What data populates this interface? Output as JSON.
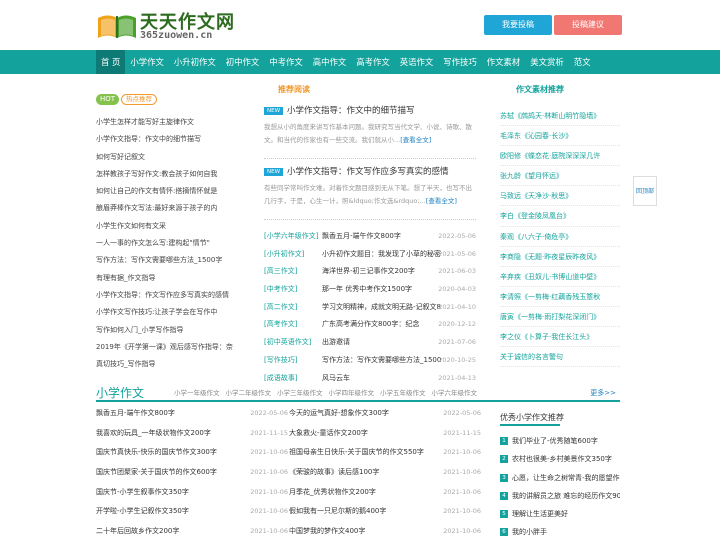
{
  "logo": {
    "cn": "天天作文网",
    "en": "365zuowen.cn"
  },
  "header": {
    "submit": "我要投稿",
    "suggest": "投稿建议"
  },
  "nav": [
    "首 页",
    "小学作文",
    "小升初作文",
    "初中作文",
    "中考作文",
    "高中作文",
    "高考作文",
    "英语作文",
    "写作技巧",
    "作文素材",
    "美文赏析",
    "范文"
  ],
  "hot": {
    "tag": "HOT",
    "sub": "热点推荐",
    "items": [
      "小学生怎样才能写好主旋律作文",
      "小学作文指导：作文中的细节描写",
      "如何写好记叙文",
      "怎样教孩子写好作文:教会孩子如何自我",
      "如何让自己的作文有情怀:搭摘情怀就是",
      "酿眉莽棒作文写法:最好来源于孩子的内",
      "小学生作文如何有文采",
      "一人一事的作文怎么写:建构起\"情节\"",
      "写作方法：写作文需要哪些方法_1500字",
      "有理有据_作文指导",
      "小学作文指导：作文写作应多写真实的感情",
      "小学作文写作技巧:让孩子学会在写作中",
      "写作如何入门_小学写作指导",
      "2019年《开学第一课》观后感写作指导：奈",
      "真切技巧_写作指导"
    ]
  },
  "recommend": {
    "title": "推荐阅读",
    "more": "[查看全文]",
    "articles": [
      {
        "badge": "NEW",
        "title": "小学作文指导：作文中的细节描写",
        "summary": "我想从小的角度来讲写作基本问题。我研究写当代文学、小说、诗歌、散文。和当代的作家也有一些交流。我们就从小..."
      },
      {
        "badge": "NEW",
        "title": "小学作文指导：作文写作应多写真实的感情",
        "summary": "有些同学常叫作文难。对着作文题目感到无从下笔。想了半天，也写不出几行字，于是，心生一计，照&ldquo;作文选&rdquo;..."
      }
    ],
    "list": [
      {
        "cat": "[小学六年级作文]",
        "title": "飘香五月-端午作文800字",
        "date": "2022-05-06"
      },
      {
        "cat": "[小升初作文]",
        "title": "小升初作文题目：我发现了小草的秘密",
        "date": "2021-05-06"
      },
      {
        "cat": "[高三作文]",
        "title": "海洋世界-初三记事作文200字",
        "date": "2021-06-03"
      },
      {
        "cat": "[中考作文]",
        "title": "那一年 优秀中考作文1500字",
        "date": "2020-04-03"
      },
      {
        "cat": "[高二作文]",
        "title": "学习文明精神，成就文明无路-记叙文8",
        "date": "2021-04-10"
      },
      {
        "cat": "[高考作文]",
        "title": "广东高考满分作文800字：纪念",
        "date": "2020-12-12"
      },
      {
        "cat": "[初中英语作文]",
        "title": "出游邀请",
        "date": "2021-07-06"
      },
      {
        "cat": "[写作技巧]",
        "title": "写作方法：写作文需要哪些方法_1500",
        "date": "2020-10-25"
      },
      {
        "cat": "[成语故事]",
        "title": "风马云车",
        "date": "2021-04-13"
      }
    ]
  },
  "materials": {
    "title": "作文素材推荐",
    "items": [
      "苏轼《鹧鸪天·林断山明竹隐墙》",
      "毛泽东《沁园春·长沙》",
      "欧阳修《蝶恋花·庭院深深深几许",
      "张九龄《望月怀远》",
      "马致远《天净沙·秋思》",
      "李白《登金陵凤凰台》",
      "秦观《八六子·倚危亭》",
      "李商隐《无题·昨夜星辰昨夜风》",
      "辛弃疾《丑奴儿·书博山道中壁》",
      "李清照《一剪梅·红藕香残玉簟秋",
      "唐寅《一剪梅·雨打梨花深闭门》",
      "李之仪《卜算子·我住长江头》",
      "关于诚信的名言警句"
    ]
  },
  "back_top": "回顶部",
  "primary": {
    "title": "小学作文",
    "tabs": [
      "小学一年级作文",
      "小学二年级作文",
      "小学三年级作文",
      "小学四年级作文",
      "小学五年级作文",
      "小学六年级作文"
    ],
    "more": "更多>>",
    "col1": [
      {
        "title": "飘香五月-端午作文800字",
        "date": "2022-05-06"
      },
      {
        "title": "我喜欢的玩具_一年级状物作文200字",
        "date": "2021-11-15"
      },
      {
        "title": "国庆节真快乐-快乐的国庆节作文300字",
        "date": "2021-10-06"
      },
      {
        "title": "国庆节团聚家-关于国庆节的作文600字",
        "date": "2021-10-06"
      },
      {
        "title": "国庆节-小学生叙事作文350字",
        "date": "2021-10-06"
      },
      {
        "title": "开学啦-小学生记叙作文350字",
        "date": "2021-10-06"
      },
      {
        "title": "二十年后回故乡作文200字",
        "date": "2021-10-06"
      }
    ],
    "col2": [
      {
        "title": "今天的运气真好-想象作文300字",
        "date": "2022-05-06"
      },
      {
        "title": "大象救火-童话作文200字",
        "date": "2021-11-15"
      },
      {
        "title": "祖国母亲生日快乐-关于国庆节的作文550字",
        "date": "2021-10-06"
      },
      {
        "title": "《荣骏的故事》读后感100字",
        "date": "2021-10-06"
      },
      {
        "title": "月季花_优秀状物作文200字",
        "date": "2021-10-06"
      },
      {
        "title": "假如我有一只尼尔斯的鹅400字",
        "date": "2021-10-06"
      },
      {
        "title": "中国梦我的梦作文400字",
        "date": "2021-10-06"
      }
    ]
  },
  "excellent": {
    "title": "优秀小学作文推荐",
    "items": [
      "我们毕业了-优秀随笔600字",
      "农村也很美-乡村美景作文350字",
      "心愿，让生命之树常青-我的愿望作",
      "我的讲解员之旅 难忘的经历作文900",
      "理解让生活更美好",
      "我的小胖手"
    ]
  }
}
